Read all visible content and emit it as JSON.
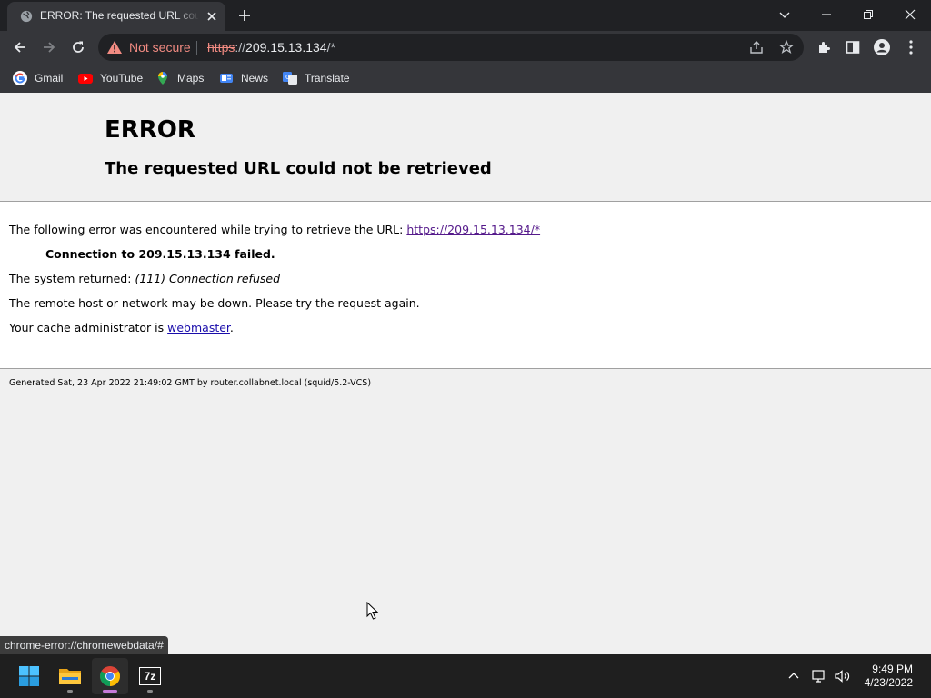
{
  "browser": {
    "tab_title": "ERROR: The requested URL could not be retrieved",
    "address": {
      "security_label": "Not secure",
      "scheme": "https",
      "rest": "://",
      "host": "209.15.13.134",
      "path": "/*"
    },
    "bookmarks": [
      {
        "label": "Gmail",
        "icon": "google-icon"
      },
      {
        "label": "YouTube",
        "icon": "youtube-icon"
      },
      {
        "label": "Maps",
        "icon": "maps-icon"
      },
      {
        "label": "News",
        "icon": "news-icon"
      },
      {
        "label": "Translate",
        "icon": "translate-icon"
      }
    ],
    "status_url": "chrome-error://chromewebdata/#"
  },
  "page": {
    "heading": "ERROR",
    "subheading": "The requested URL could not be retrieved",
    "intro_text": "The following error was encountered while trying to retrieve the URL:",
    "intro_link": "https://209.15.13.134/*",
    "failure": "Connection to 209.15.13.134 failed.",
    "system_returned_label": "The system returned:",
    "system_returned_value": "(111) Connection refused",
    "remote_down": "The remote host or network may be down. Please try the request again.",
    "admin_text": "Your cache administrator is",
    "admin_link": "webmaster",
    "admin_suffix": ".",
    "footer": "Generated Sat, 23 Apr 2022 21:49:02 GMT by router.collabnet.local (squid/5.2-VCS)"
  },
  "taskbar": {
    "apps": [
      {
        "name": "start",
        "icon": "windows-start-icon"
      },
      {
        "name": "file-explorer",
        "icon": "folder-icon"
      },
      {
        "name": "chrome",
        "icon": "chrome-icon"
      },
      {
        "name": "7zip",
        "icon": "7zip-icon",
        "label": "7z"
      }
    ],
    "time": "9:49 PM",
    "date": "4/23/2022"
  },
  "colors": {
    "chrome_dark": "#202124",
    "toolbar": "#35363a",
    "warning": "#f28b82",
    "link": "#1a0dab",
    "visited_link": "#551a8b",
    "taskbar": "#1f1f1f"
  }
}
